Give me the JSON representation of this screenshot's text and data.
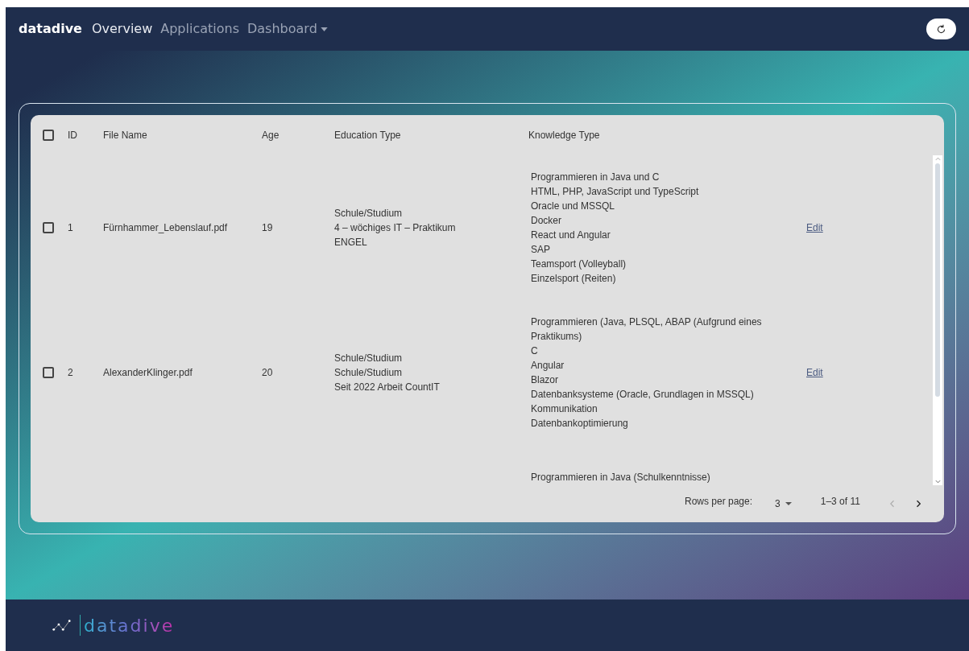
{
  "navbar": {
    "brand": "datadive",
    "links": [
      {
        "label": "Overview",
        "selected": true
      },
      {
        "label": "Applications",
        "selected": false
      },
      {
        "label": "Dashboard",
        "selected": false,
        "kind": "dropdown"
      }
    ]
  },
  "table": {
    "select_all_checked": false,
    "columns": [
      "ID",
      "File Name",
      "Age",
      "Education Type",
      "Knowledge Type"
    ],
    "rows": [
      {
        "checked": false,
        "id": "1",
        "file_name": "Fürnhammer_Lebenslauf.pdf",
        "age": "19",
        "education": [
          "Schule/Studium",
          "4 – wöchiges IT – Praktikum",
          "ENGEL"
        ],
        "knowledge": [
          "Programmieren in Java und C",
          "HTML, PHP, JavaScript und TypeScript",
          "Oracle und MSSQL",
          "Docker",
          "React und Angular",
          "SAP",
          "Teamsport (Volleyball)",
          "Einzelsport (Reiten)"
        ],
        "action": "Edit"
      },
      {
        "checked": false,
        "id": "2",
        "file_name": "AlexanderKlinger.pdf",
        "age": "20",
        "education": [
          "Schule/Studium",
          "Schule/Studium",
          "Seit 2022 Arbeit CountIT"
        ],
        "knowledge": [
          "Programmieren (Java, PLSQL, ABAP (Aufgrund eines Praktikums)",
          "C",
          "Angular",
          "Blazor",
          "Datenbanksysteme (Oracle, Grundlagen in MSSQL)",
          "Kommunikation",
          "Datenbankoptimierung"
        ],
        "action": "Edit"
      },
      {
        "kind": "partial",
        "knowledge": [
          "Programmieren in Java (Schulkenntnisse)"
        ]
      }
    ],
    "pagination": {
      "rows_per_page_label": "Rows per page:",
      "rows_per_page": "3",
      "range": "1–3 of 11",
      "prev_disabled": true,
      "next_disabled": false
    }
  },
  "footer": {
    "logo_text": "datadive"
  }
}
